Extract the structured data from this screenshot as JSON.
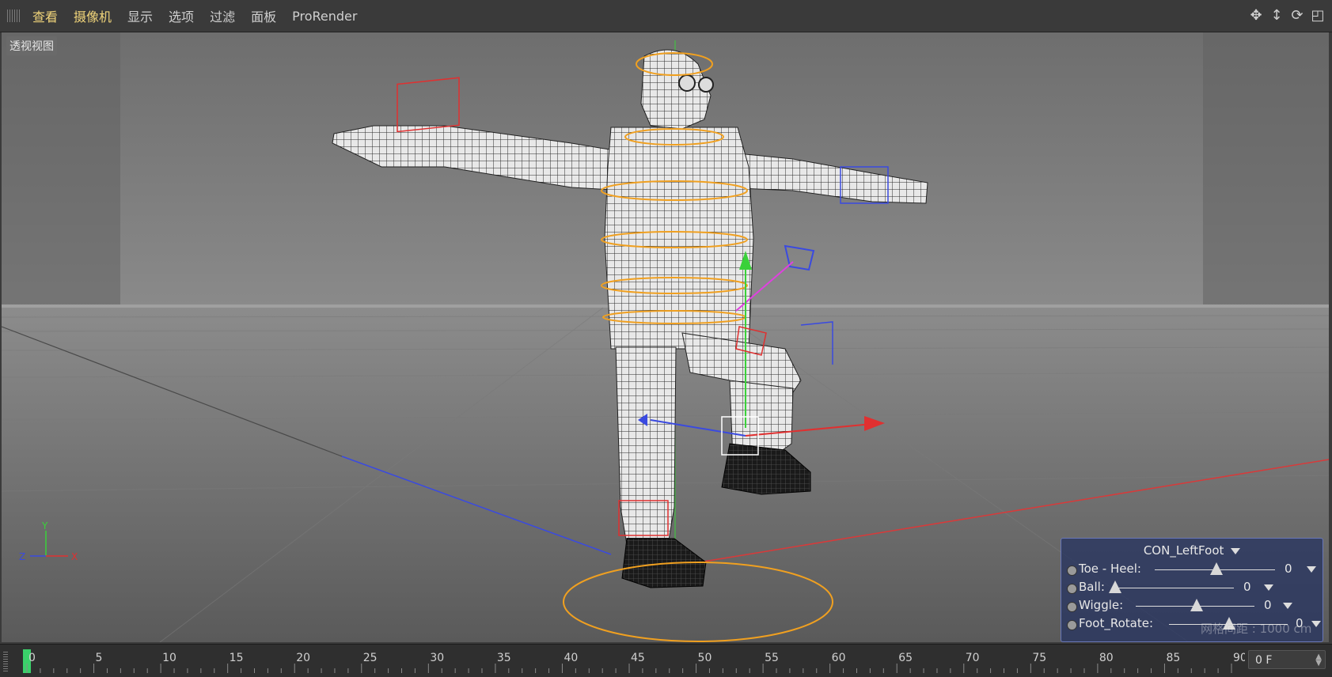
{
  "menu": {
    "items": [
      {
        "label": "查看",
        "active": true
      },
      {
        "label": "摄像机",
        "active": true
      },
      {
        "label": "显示",
        "active": false
      },
      {
        "label": "选项",
        "active": false
      },
      {
        "label": "过滤",
        "active": false
      },
      {
        "label": "面板",
        "active": false
      },
      {
        "label": "ProRender",
        "active": false
      }
    ],
    "tool_icons": [
      "move-view-icon",
      "pan-view-icon",
      "rotate-view-icon",
      "maximize-view-icon"
    ]
  },
  "viewport": {
    "label": "透视视图",
    "axis": {
      "x": "X",
      "y": "Y",
      "z": "Z"
    },
    "colors": {
      "x_axis": "#e03a3a",
      "y_axis": "#3ad13a",
      "z_axis": "#3a5ae0",
      "rig": "#f0a020"
    }
  },
  "hud": {
    "title": "CON_LeftFoot",
    "rows": [
      {
        "label": "Toe - Heel:",
        "value": "0",
        "slider": 0.5
      },
      {
        "label": "Ball:",
        "value": "0",
        "slider": 0.0
      },
      {
        "label": "Wiggle:",
        "value": "0",
        "slider": 0.5
      },
      {
        "label": "Foot_Rotate:",
        "value": "0",
        "slider": 0.5
      }
    ],
    "grid_spacing": "网格间距 : 1000 cm"
  },
  "timeline": {
    "ticks": [
      0,
      5,
      10,
      15,
      20,
      25,
      30,
      35,
      40,
      45,
      50,
      55,
      60,
      65,
      70,
      75,
      80,
      85,
      90
    ],
    "current_frame": 0,
    "frame_field": "0 F"
  }
}
